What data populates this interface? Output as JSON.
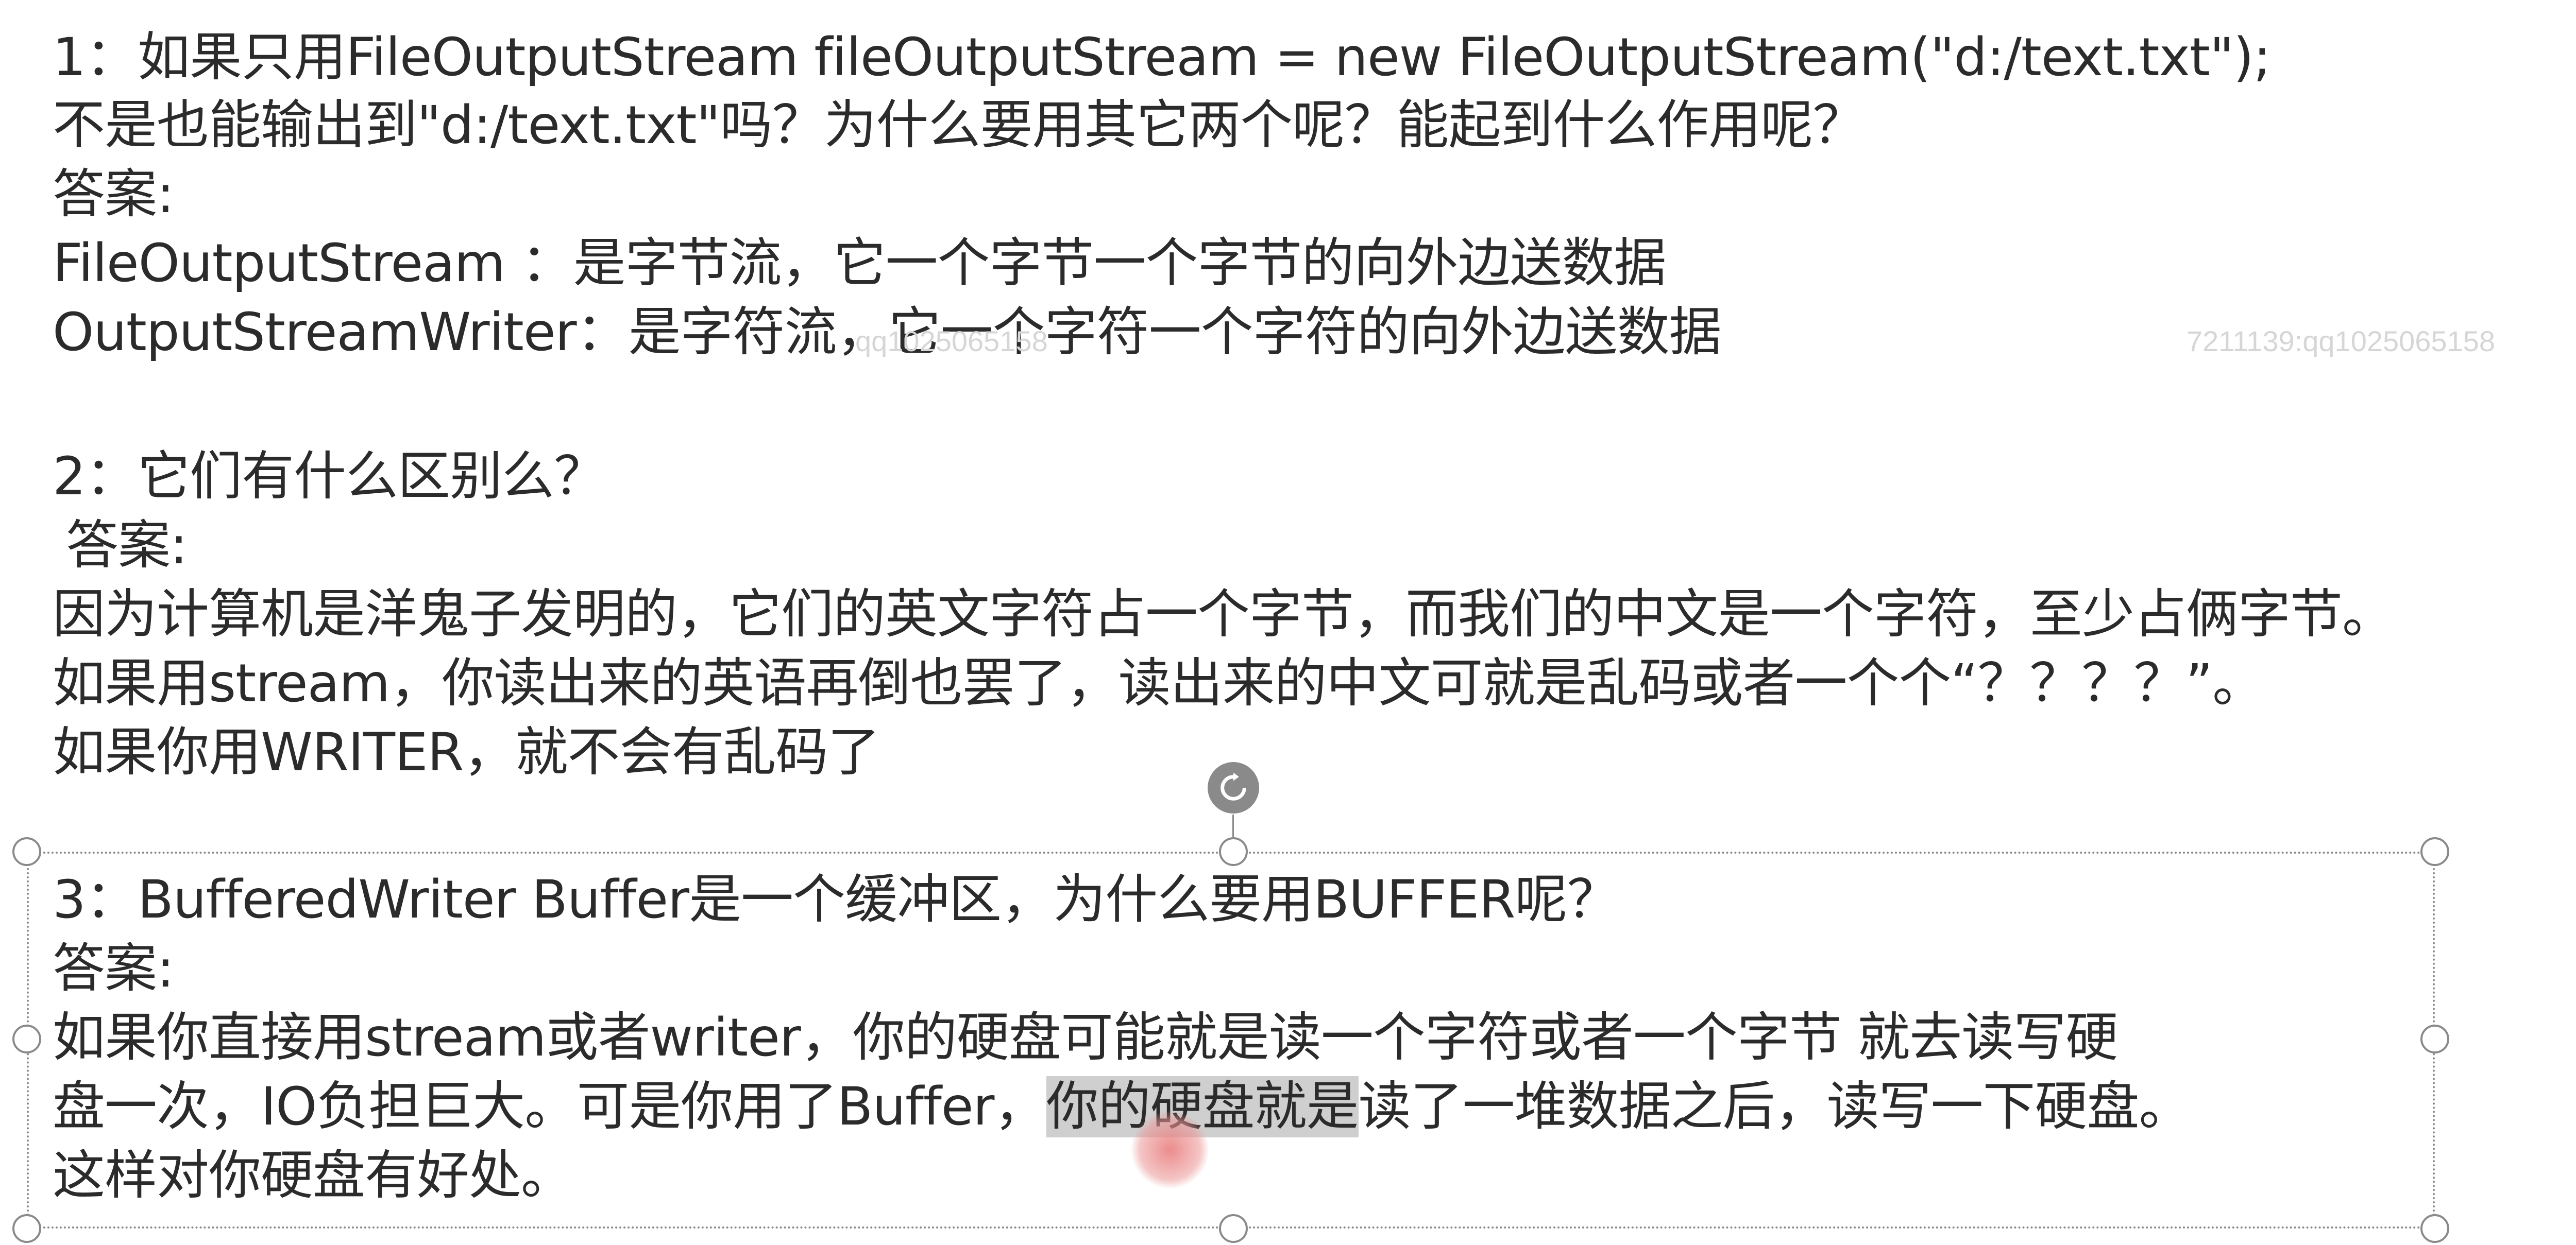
{
  "document": {
    "q1": {
      "line1": "1：如果只用FileOutputStream fileOutputStream = new FileOutputStream(\"d:/text.txt\");",
      "line2": "不是也能输出到\"d:/text.txt\"吗？为什么要用其它两个呢？能起到什么作用呢？",
      "answer_label": "答案:",
      "answer_line1": "FileOutputStream  ：是字节流，它一个字节一个字节的向外边送数据",
      "answer_line2": "OutputStreamWriter：是字符流，它一个字符一个字符的向外边送数据"
    },
    "q2": {
      "question": "2：它们有什么区别么？",
      "answer_label": "答案:",
      "answer_line1": "因为计算机是洋鬼子发明的，它们的英文字符占一个字节，而我们的中文是一个字符，至少占俩字节。",
      "answer_line2": "如果用stream，你读出来的英语再倒也罢了，读出来的中文可就是乱码或者一个个“？？？？”。",
      "answer_line3": "如果你用WRITER，就不会有乱码了"
    },
    "q3": {
      "question": "3：BufferedWriter  Buffer是一个缓冲区，为什么要用BUFFER呢？",
      "answer_label": "答案:",
      "answer_line1": "如果你直接用stream或者writer，你的硬盘可能就是读一个字符或者一个字节   就去读写硬",
      "answer_line2_prefix": "盘一次，IO负担巨大。可是你用了Buffer，",
      "answer_line2_highlight": "你的硬盘就是",
      "answer_line2_suffix": "读了一堆数据之后，读写一下硬盘。",
      "answer_line3": "这样对你硬盘有好处。"
    }
  },
  "watermarks": {
    "left": "qq1025065158",
    "right": "7211139:qq1025065158"
  },
  "colors": {
    "text": "#2b2b2b",
    "selection": "#8a8a8a",
    "highlight": "#cfcfcf",
    "cursor": "#e87878"
  },
  "icons": {
    "rotate_handle": "rotate-icon"
  }
}
